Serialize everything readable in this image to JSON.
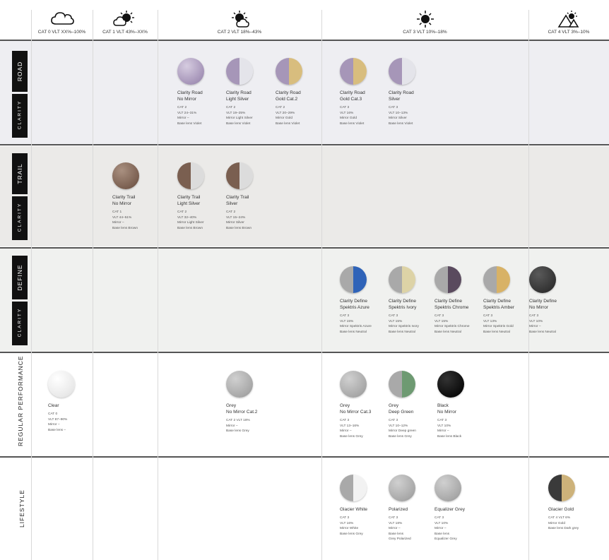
{
  "columns": [
    {
      "icon": "cloud-icon",
      "label": "CAT 0 VLT XX%–100%"
    },
    {
      "icon": "sun-cloud-icon",
      "label": "CAT 1 VLT 43%–XX%"
    },
    {
      "icon": "sun-cloud-icon",
      "label": "CAT 2 VLT 18%–43%"
    },
    {
      "icon": "sun-icon",
      "label": "CAT 3 VLT 10%–18%"
    },
    {
      "icon": "mountain-sun-icon",
      "label": "CAT 4 VLT 3%–10%"
    }
  ],
  "sections": [
    {
      "top_label": "ROAD",
      "bottom_label": "CLARITY"
    },
    {
      "top_label": "TRAIL",
      "bottom_label": "CLARITY"
    },
    {
      "top_label": "DEFINE",
      "bottom_label": "CLARITY"
    },
    {
      "label": "REGULAR PERFORMANCE"
    },
    {
      "label": "LIFESTYLE"
    }
  ],
  "lenses": [
    {
      "name": "Clarity Road\nNo Mirror",
      "spec": "CAT 2\nVLT 24–31%\nMirror –\nBase lens Violet",
      "style": "violet"
    },
    {
      "name": "Clarity Road\nLight Silver",
      "spec": "CAT 2\nVLT 19–25%\nMirror Light Silver\nBase lens Violet",
      "style": "violet-silver"
    },
    {
      "name": "Clarity Road\nGold Cat.2",
      "spec": "CAT 2\nVLT 20–29%\nMirror Gold\nBase lens Violet",
      "style": "violet-gold"
    },
    {
      "name": "Clarity Road\nGold Cat.3",
      "spec": "CAT 3\nVLT 16%\nMirror Gold\nBase lens Violet",
      "style": "violet-gold"
    },
    {
      "name": "Clarity Road\nSilver",
      "spec": "CAT 3\nVLT 10–13%\nMirror Silver\nBase lens Violet",
      "style": "violet-silver"
    },
    {
      "name": "Clarity Trail\nNo Mirror",
      "spec": "CAT 1\nVLT 44–51%\nMirror –\nBase lens Brown",
      "style": "brown"
    },
    {
      "name": "Clarity Trail\nLight Silver",
      "spec": "CAT 2\nVLT 32–40%\nMirror Light Silver\nBase lens Brown",
      "style": "brown-silver"
    },
    {
      "name": "Clarity Trail\nSilver",
      "spec": "CAT 2\nVLT 15–24%\nMirror Silver\nBase lens Brown",
      "style": "brown-silver"
    },
    {
      "name": "Clarity Define\nSpektris Azure",
      "spec": "CAT 3\nVLT 15%\nMirror Spektris Azure\nBase lens Neutral",
      "style": "grey-azure"
    },
    {
      "name": "Clarity Define\nSpektris Ivory",
      "spec": "CAT 3\nVLT 15%\nMirror Spektris Ivory\nBase lens Neutral",
      "style": "grey-ivory"
    },
    {
      "name": "Clarity Define\nSpektris Chrome",
      "spec": "CAT 3\nVLT 15%\nMirror Spektris Chrome\nBase lens Neutral",
      "style": "grey-chrome"
    },
    {
      "name": "Clarity Define\nSpektris Amber",
      "spec": "CAT 3\nVLT 13%\nMirror Spektris Gold\nBase lens Neutral",
      "style": "grey-amber"
    },
    {
      "name": "Clarity Define\nNo Mirror",
      "spec": "CAT 3\nVLT 10%\nMirror –\nBase lens Neutral",
      "style": "dark"
    },
    {
      "name": "Clear",
      "spec": "CAT 0\nVLT 87–90%\nMirror –\nBase lens –",
      "style": "clear"
    },
    {
      "name": "Grey\nNo Mirror Cat.2",
      "spec": "CAT 2  VLT 18%\nMirror –\nBase lens Grey",
      "style": "grey"
    },
    {
      "name": "Grey\nNo Mirror Cat.3",
      "spec": "CAT 3\nVLT 13–16%\nMirror –\nBase lens Grey",
      "style": "grey"
    },
    {
      "name": "Grey\nDeep Green",
      "spec": "CAT 3\nVLT 10–12%\nMirror Deep green\nBase lens Grey",
      "style": "grey-green"
    },
    {
      "name": "Black\nNo Mirror",
      "spec": "CAT 3\nVLT 10%\nMirror –\nBase lens Black",
      "style": "black"
    },
    {
      "name": "Glacier White",
      "spec": "CAT 3\nVLT 16%\nMirror White\nBase lens Grey",
      "style": "grey-white"
    },
    {
      "name": "Polarized",
      "spec": "CAT 3\nVLT 18%\nMirror –\nBase lens\nGrey Polarized",
      "style": "grey"
    },
    {
      "name": "Equalizer Grey",
      "spec": "CAT 3\nVLT 10%\nMirror –\nBase lens\nEqualizer Grey",
      "style": "grey"
    },
    {
      "name": "Glacier Gold",
      "spec": "CAT 4  VLT 6%\nMirror Gold\nBase lens Dark grey",
      "style": "dark-gold"
    }
  ]
}
